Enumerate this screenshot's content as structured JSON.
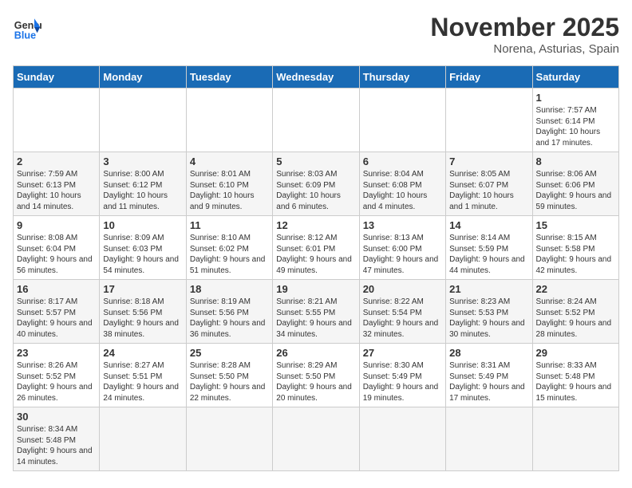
{
  "header": {
    "logo_general": "General",
    "logo_blue": "Blue",
    "month_title": "November 2025",
    "location": "Norena, Asturias, Spain"
  },
  "days_of_week": [
    "Sunday",
    "Monday",
    "Tuesday",
    "Wednesday",
    "Thursday",
    "Friday",
    "Saturday"
  ],
  "weeks": [
    [
      {
        "day": "",
        "info": ""
      },
      {
        "day": "",
        "info": ""
      },
      {
        "day": "",
        "info": ""
      },
      {
        "day": "",
        "info": ""
      },
      {
        "day": "",
        "info": ""
      },
      {
        "day": "",
        "info": ""
      },
      {
        "day": "1",
        "info": "Sunrise: 7:57 AM\nSunset: 6:14 PM\nDaylight: 10 hours and 17 minutes."
      }
    ],
    [
      {
        "day": "2",
        "info": "Sunrise: 7:59 AM\nSunset: 6:13 PM\nDaylight: 10 hours and 14 minutes."
      },
      {
        "day": "3",
        "info": "Sunrise: 8:00 AM\nSunset: 6:12 PM\nDaylight: 10 hours and 11 minutes."
      },
      {
        "day": "4",
        "info": "Sunrise: 8:01 AM\nSunset: 6:10 PM\nDaylight: 10 hours and 9 minutes."
      },
      {
        "day": "5",
        "info": "Sunrise: 8:03 AM\nSunset: 6:09 PM\nDaylight: 10 hours and 6 minutes."
      },
      {
        "day": "6",
        "info": "Sunrise: 8:04 AM\nSunset: 6:08 PM\nDaylight: 10 hours and 4 minutes."
      },
      {
        "day": "7",
        "info": "Sunrise: 8:05 AM\nSunset: 6:07 PM\nDaylight: 10 hours and 1 minute."
      },
      {
        "day": "8",
        "info": "Sunrise: 8:06 AM\nSunset: 6:06 PM\nDaylight: 9 hours and 59 minutes."
      }
    ],
    [
      {
        "day": "9",
        "info": "Sunrise: 8:08 AM\nSunset: 6:04 PM\nDaylight: 9 hours and 56 minutes."
      },
      {
        "day": "10",
        "info": "Sunrise: 8:09 AM\nSunset: 6:03 PM\nDaylight: 9 hours and 54 minutes."
      },
      {
        "day": "11",
        "info": "Sunrise: 8:10 AM\nSunset: 6:02 PM\nDaylight: 9 hours and 51 minutes."
      },
      {
        "day": "12",
        "info": "Sunrise: 8:12 AM\nSunset: 6:01 PM\nDaylight: 9 hours and 49 minutes."
      },
      {
        "day": "13",
        "info": "Sunrise: 8:13 AM\nSunset: 6:00 PM\nDaylight: 9 hours and 47 minutes."
      },
      {
        "day": "14",
        "info": "Sunrise: 8:14 AM\nSunset: 5:59 PM\nDaylight: 9 hours and 44 minutes."
      },
      {
        "day": "15",
        "info": "Sunrise: 8:15 AM\nSunset: 5:58 PM\nDaylight: 9 hours and 42 minutes."
      }
    ],
    [
      {
        "day": "16",
        "info": "Sunrise: 8:17 AM\nSunset: 5:57 PM\nDaylight: 9 hours and 40 minutes."
      },
      {
        "day": "17",
        "info": "Sunrise: 8:18 AM\nSunset: 5:56 PM\nDaylight: 9 hours and 38 minutes."
      },
      {
        "day": "18",
        "info": "Sunrise: 8:19 AM\nSunset: 5:56 PM\nDaylight: 9 hours and 36 minutes."
      },
      {
        "day": "19",
        "info": "Sunrise: 8:21 AM\nSunset: 5:55 PM\nDaylight: 9 hours and 34 minutes."
      },
      {
        "day": "20",
        "info": "Sunrise: 8:22 AM\nSunset: 5:54 PM\nDaylight: 9 hours and 32 minutes."
      },
      {
        "day": "21",
        "info": "Sunrise: 8:23 AM\nSunset: 5:53 PM\nDaylight: 9 hours and 30 minutes."
      },
      {
        "day": "22",
        "info": "Sunrise: 8:24 AM\nSunset: 5:52 PM\nDaylight: 9 hours and 28 minutes."
      }
    ],
    [
      {
        "day": "23",
        "info": "Sunrise: 8:26 AM\nSunset: 5:52 PM\nDaylight: 9 hours and 26 minutes."
      },
      {
        "day": "24",
        "info": "Sunrise: 8:27 AM\nSunset: 5:51 PM\nDaylight: 9 hours and 24 minutes."
      },
      {
        "day": "25",
        "info": "Sunrise: 8:28 AM\nSunset: 5:50 PM\nDaylight: 9 hours and 22 minutes."
      },
      {
        "day": "26",
        "info": "Sunrise: 8:29 AM\nSunset: 5:50 PM\nDaylight: 9 hours and 20 minutes."
      },
      {
        "day": "27",
        "info": "Sunrise: 8:30 AM\nSunset: 5:49 PM\nDaylight: 9 hours and 19 minutes."
      },
      {
        "day": "28",
        "info": "Sunrise: 8:31 AM\nSunset: 5:49 PM\nDaylight: 9 hours and 17 minutes."
      },
      {
        "day": "29",
        "info": "Sunrise: 8:33 AM\nSunset: 5:48 PM\nDaylight: 9 hours and 15 minutes."
      }
    ],
    [
      {
        "day": "30",
        "info": "Sunrise: 8:34 AM\nSunset: 5:48 PM\nDaylight: 9 hours and 14 minutes."
      },
      {
        "day": "",
        "info": ""
      },
      {
        "day": "",
        "info": ""
      },
      {
        "day": "",
        "info": ""
      },
      {
        "day": "",
        "info": ""
      },
      {
        "day": "",
        "info": ""
      },
      {
        "day": "",
        "info": ""
      }
    ]
  ]
}
